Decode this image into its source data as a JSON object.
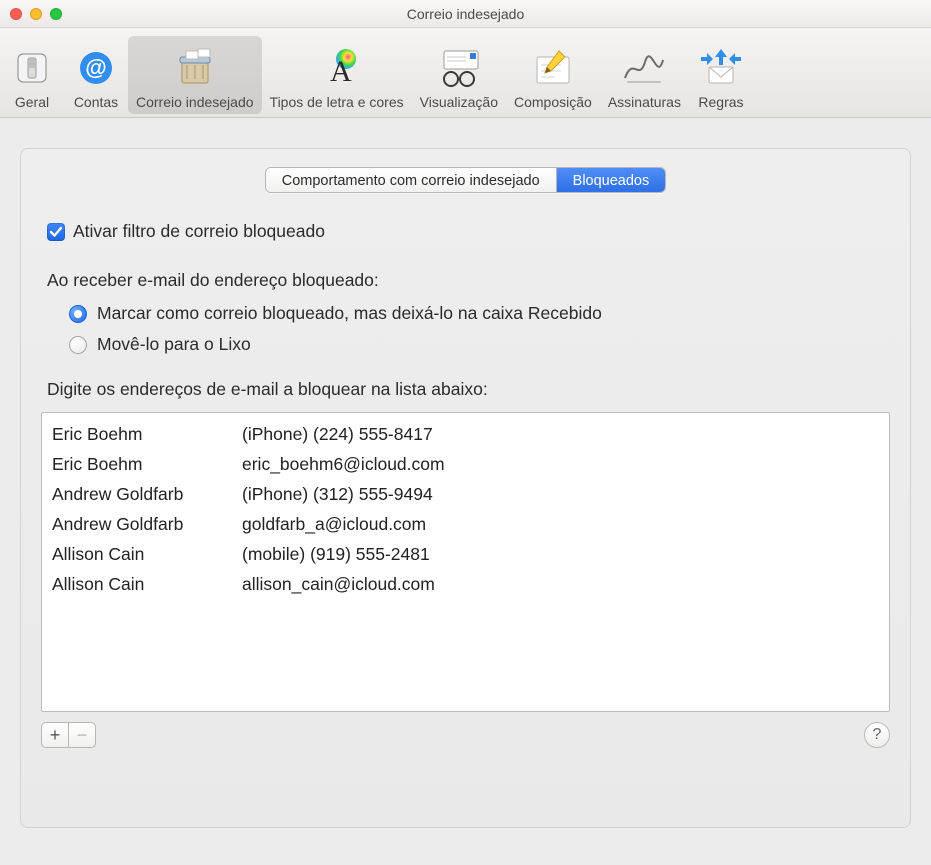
{
  "window": {
    "title": "Correio indesejado"
  },
  "toolbar": {
    "items": [
      {
        "label": "Geral"
      },
      {
        "label": "Contas"
      },
      {
        "label": "Correio indesejado"
      },
      {
        "label": "Tipos de letra e cores"
      },
      {
        "label": "Visualização"
      },
      {
        "label": "Composição"
      },
      {
        "label": "Assinaturas"
      },
      {
        "label": "Regras"
      }
    ]
  },
  "tabs": {
    "junk": "Comportamento com correio indesejado",
    "blocked": "Bloqueados"
  },
  "checkbox": {
    "label": "Ativar filtro de correio bloqueado",
    "checked": true
  },
  "section": {
    "receiveLabel": "Ao receber e-mail do endereço bloqueado:"
  },
  "radios": {
    "markLeave": "Marcar como correio bloqueado, mas deixá-lo na caixa Recebido",
    "moveTrash": "Movê-lo para o Lixo"
  },
  "list": {
    "prompt": "Digite os endereços de e-mail a bloquear na lista abaixo:",
    "rows": [
      {
        "name": "Eric Boehm",
        "contact": "(iPhone) (224) 555-8417"
      },
      {
        "name": "Eric Boehm",
        "contact": "eric_boehm6@icloud.com"
      },
      {
        "name": "Andrew Goldfarb",
        "contact": "(iPhone) (312) 555-9494"
      },
      {
        "name": "Andrew Goldfarb",
        "contact": "goldfarb_a@icloud.com"
      },
      {
        "name": "Allison Cain",
        "contact": "(mobile) (919) 555-2481"
      },
      {
        "name": "Allison Cain",
        "contact": "allison_cain@icloud.com"
      }
    ]
  },
  "buttons": {
    "add": "+",
    "remove": "−",
    "help": "?"
  }
}
